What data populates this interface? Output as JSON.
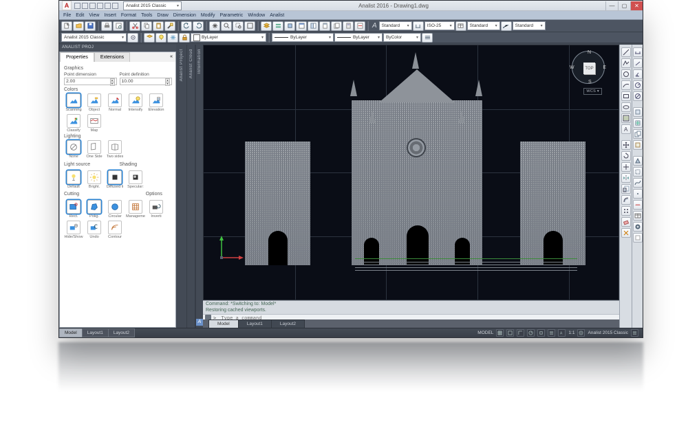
{
  "title": "Analist 2016 - Drawing1.dwg",
  "qat_dropdown_label": "Analist 2015 Classic",
  "menu": [
    "File",
    "Edit",
    "View",
    "Insert",
    "Format",
    "Tools",
    "Draw",
    "Dimension",
    "Modify",
    "Parametric",
    "Window",
    "Analist"
  ],
  "toolbar2": {
    "workspace": "Analist 2015 Classic",
    "layer": "ByLayer",
    "linetype": "ByLayer",
    "color": "ByColor",
    "textstyle": "Standard",
    "dimstyle": "ISO-25",
    "tablestyle": "Standard",
    "mlstyle": "Standard",
    "annotation_letter": "A"
  },
  "proj_label": "ANALIST PROJ",
  "props": {
    "tabs": [
      "Properties",
      "Extensions"
    ],
    "graphics": "Graphics",
    "point_dim_label": "Point dimension",
    "point_def_label": "Point definition",
    "point_dim": "2.00",
    "point_def": "10.00",
    "colors_label": "Colors",
    "colors": [
      "Scanning",
      "Object",
      "Normal",
      "Intensify",
      "Elevation",
      "Classify",
      "Map"
    ],
    "lighting_label": "Lighting",
    "lighting": [
      "None",
      "One Side",
      "Two sides"
    ],
    "light_source_label": "Light source",
    "shading_label": "Shading",
    "light_source": [
      "Default",
      "Bright."
    ],
    "shading": [
      "Diffused li",
      "Specular:"
    ],
    "cutting_label": "Cutting",
    "options_label": "Options",
    "cutting": [
      "Rect.",
      "Polig.",
      "Circular",
      "Manageme",
      "Inverti",
      "Hide/Show",
      "Undo",
      "Contour"
    ]
  },
  "vstrips": {
    "a": "Analist Project",
    "b": "Analist Cloud",
    "c": "Information"
  },
  "wcs": "WCS",
  "viewcube_face": "TOP",
  "cmd": {
    "l1": "Command:  *Switching to: Model*",
    "l2": "Restoring cached viewports.",
    "placeholder": "Type a command"
  },
  "model_tabs": [
    "Model",
    "Layout1",
    "Layout2"
  ],
  "status": {
    "model": "MODEL",
    "scale": "1:1",
    "workspace": "Analist 2015 Classic"
  }
}
